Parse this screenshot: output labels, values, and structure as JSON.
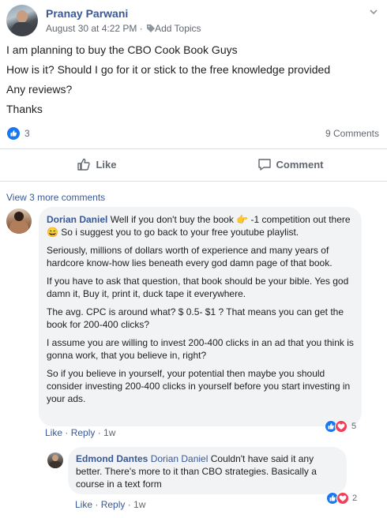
{
  "post": {
    "author": "Pranay Parwani",
    "date": "August 30 at 4:22 PM",
    "separator": " · ",
    "add_topics": "Add Topics",
    "lines": [
      "I am planning to buy the CBO Cook Book Guys",
      "How is it? Should I go for it or stick to the free knowledge provided",
      "Any reviews?",
      "Thanks"
    ],
    "reaction_count": "3",
    "comments_label": "9 Comments"
  },
  "actions": {
    "like": "Like",
    "comment": "Comment"
  },
  "view_more": "View 3 more comments",
  "comments": [
    {
      "author": "Dorian Daniel",
      "paragraphs": [
        {
          "a": " Well if you don't buy the book ",
          "b": " -1 competition out there ",
          "c": " So i suggest you to go back to your free youtube playlist."
        },
        "Seriously, millions of dollars worth of experience and many years of hardcore know-how lies beneath every god damn page of that book.",
        "If you have to ask that question, that book should be your bible. Yes god damn it, Buy it, print it, duck tape it everywhere.",
        "The avg. CPC is around what? $ 0.5- $1 ? That means you can get the book for 200-400 clicks?",
        "I assume you are willing to invest 200-400 clicks in an ad that you think is gonna work, that you believe in, right?",
        "So if you believe in yourself, your potential then maybe you should consider investing 200-400 clicks in yourself before you start investing in your ads."
      ],
      "like": "Like",
      "reply": "Reply",
      "time": "1w",
      "reaction_count": "5"
    },
    {
      "author": "Edmond Dantes",
      "tagged": "Dorian Daniel",
      "text": " Couldn't have said it any better. There's more to it than CBO strategies. Basically a course in a text form",
      "like": "Like",
      "reply": "Reply",
      "time": "1w",
      "reaction_count": "2"
    }
  ],
  "emoji": {
    "pointing": "👉",
    "smile": "😄"
  },
  "colors": {
    "link": "#385898",
    "like_blue": "#1877f2",
    "love_red": "#f33e58",
    "bubble_bg": "#f2f3f5"
  }
}
